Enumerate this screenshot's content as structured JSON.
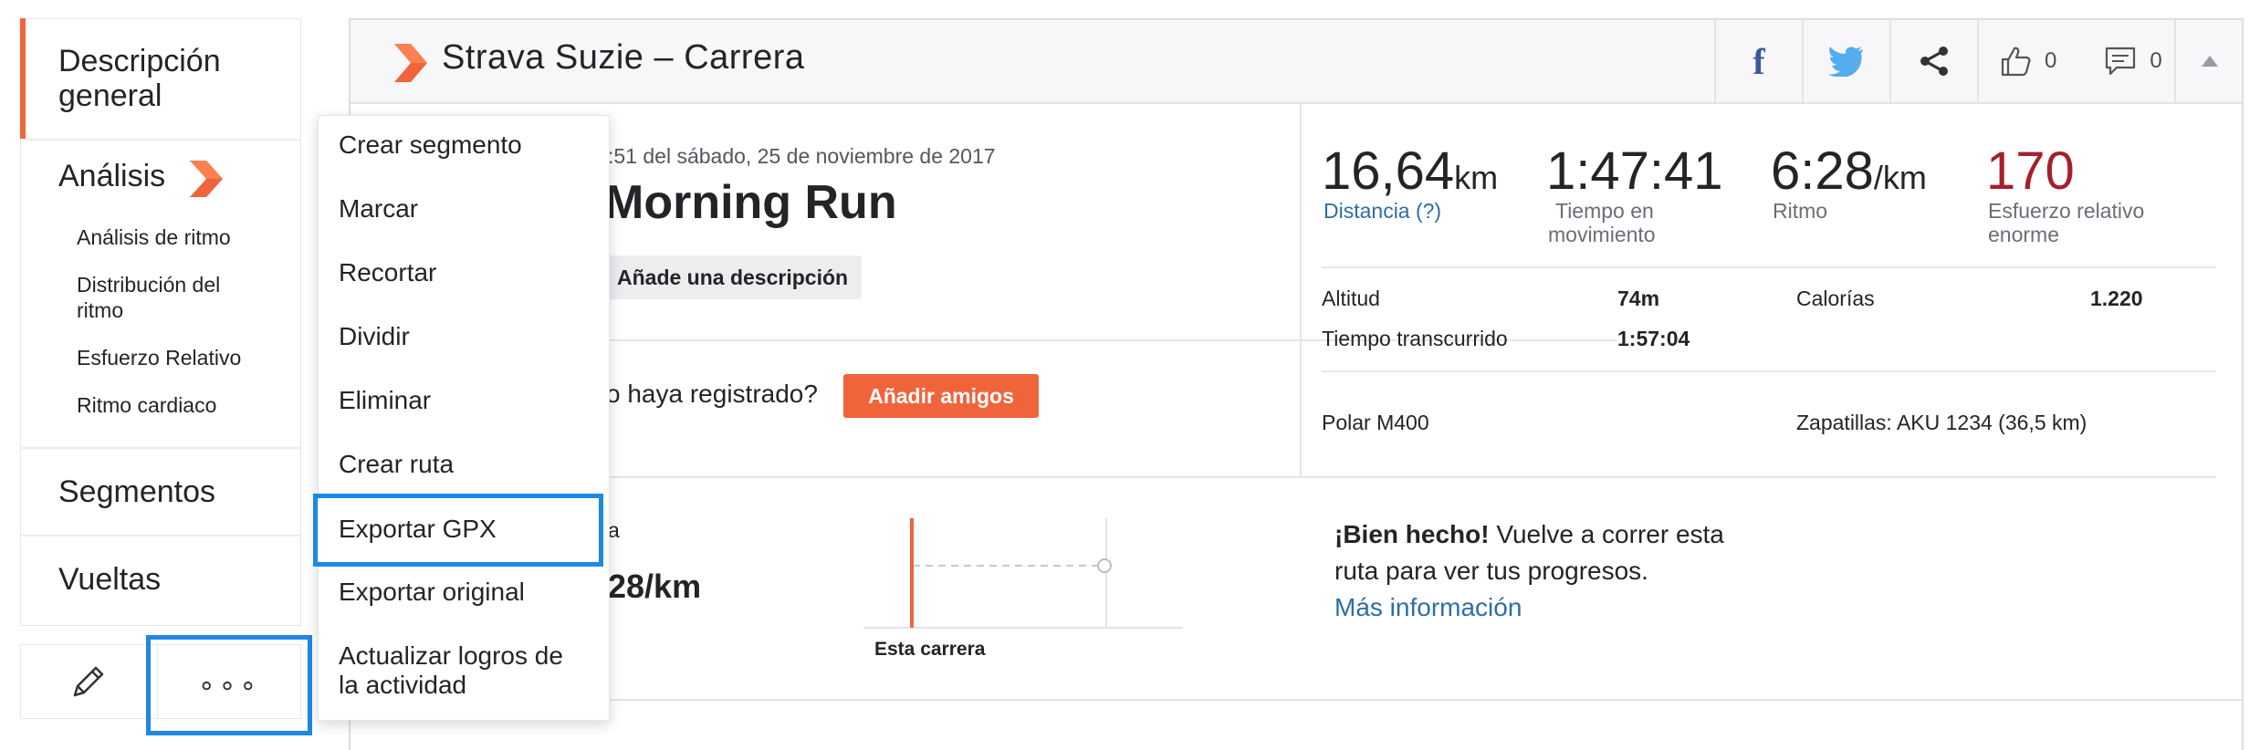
{
  "sidebar": {
    "overview_line1": "Descripción",
    "overview_line2": "general",
    "analysis": "Análisis",
    "sub_items": [
      "Análisis de ritmo",
      "Distribución del",
      "ritmo",
      "Esfuerzo Relativo",
      "Ritmo cardiaco"
    ],
    "segments": "Segmentos",
    "laps": "Vueltas",
    "edit_icon": "pencil-icon",
    "more_icon": "more-dots-icon",
    "more_label": "∘∘∘"
  },
  "header": {
    "title": "Strava Suzie – Carrera",
    "kudos_count": "0",
    "comments_count": "0",
    "icons": [
      "facebook-icon",
      "twitter-icon",
      "share-icon",
      "thumbs-up-icon",
      "comment-icon",
      "collapse-icon"
    ]
  },
  "activity": {
    "datetime": ":51 del sábado, 25 de noviembre de 2017",
    "name": "Morning Run",
    "add_description": "Añade una descripción",
    "friends_prompt": "o haya registrado?",
    "add_friends": "Añadir amigos"
  },
  "stats": {
    "distance_value": "16,64",
    "distance_unit": "km",
    "distance_label": "Distancia (?)",
    "moving_time_value": "1:47:41",
    "moving_time_label_1": "Tiempo en",
    "moving_time_label_2": "movimiento",
    "pace_value": "6:28",
    "pace_unit": "/km",
    "pace_label": "Ritmo",
    "effort_value": "170",
    "effort_label_1": "Esfuerzo relativo",
    "effort_label_2": "enorme",
    "elevation_label": "Altitud",
    "elevation_value": "74m",
    "calories_label": "Calorías",
    "calories_value": "1.220",
    "elapsed_label": "Tiempo transcurrido",
    "elapsed_value": "1:57:04",
    "device": "Polar M400",
    "shoes": "Zapatillas: AKU 1234 (36,5 km)"
  },
  "comparison": {
    "partial_label": "a",
    "pace": "28/km",
    "chart_label": "Esta carrera",
    "message_bold": "¡Bien hecho!",
    "message_rest": " Vuelve a correr esta",
    "message_line2": "ruta para ver tus progresos.",
    "more_info": "Más información"
  },
  "colors": {
    "accent": "#f0643c",
    "link": "#2e6da4",
    "effort": "#a51f2d",
    "highlight": "#1e88e5"
  },
  "menu": {
    "items": [
      "Crear segmento",
      "Marcar",
      "Recortar",
      "Dividir",
      "Eliminar",
      "Crear ruta",
      "Exportar GPX",
      "Exportar original",
      "Actualizar logros de",
      "la actividad"
    ],
    "highlighted": "Exportar GPX"
  }
}
